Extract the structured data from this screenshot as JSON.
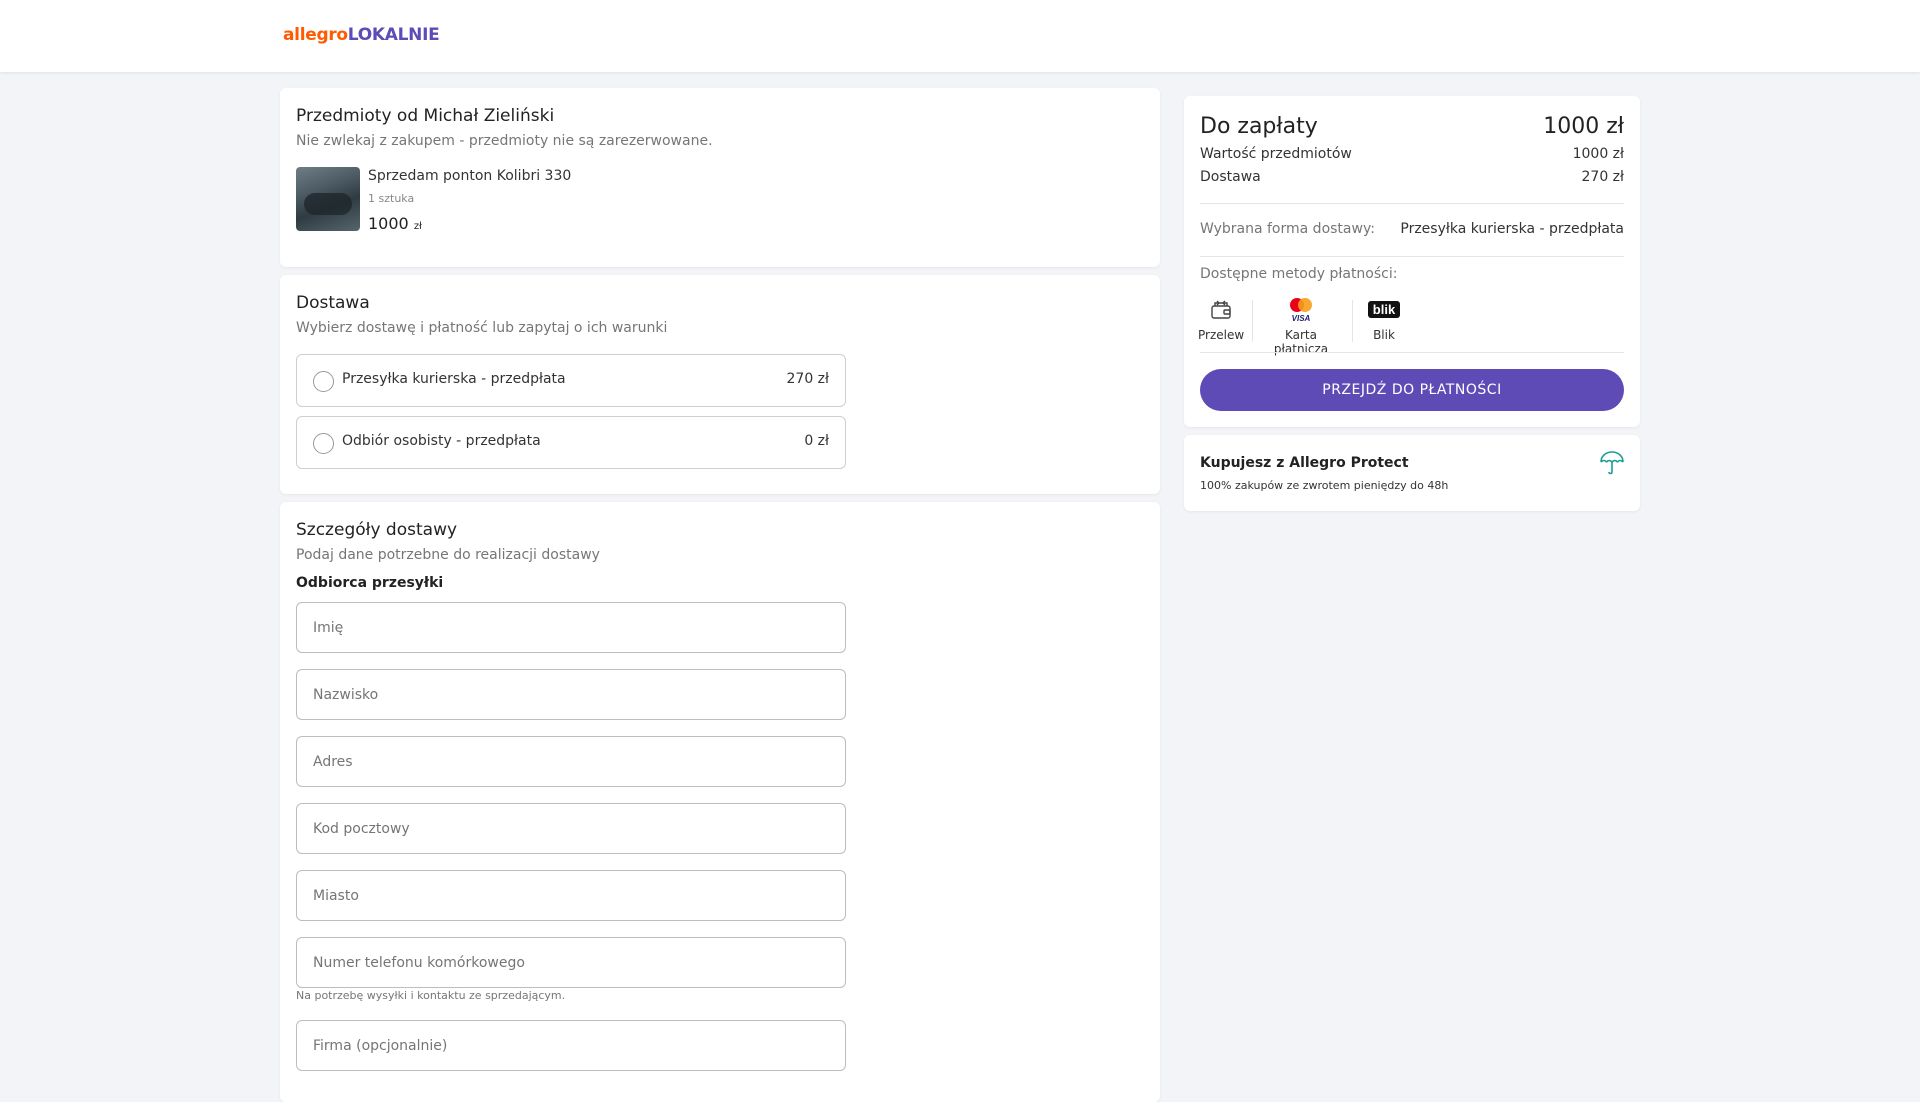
{
  "header": {
    "logo_part1": "allegro",
    "logo_part2": "LOKALNIE"
  },
  "items": {
    "title": "Przedmioty od Michał Zieliński",
    "subtitle": "Nie zwlekaj z zakupem - przedmioty nie są zarezerwowane.",
    "item": {
      "name": "Sprzedam ponton Kolibri 330",
      "qty": "1 sztuka",
      "price": "1000",
      "currency": "zł"
    }
  },
  "delivery": {
    "title": "Dostawa",
    "subtitle": "Wybierz dostawę i płatność lub zapytaj o ich warunki",
    "options": [
      {
        "label": "Przesyłka kurierska - przedpłata",
        "price": "270 zł"
      },
      {
        "label": "Odbiór osobisty - przedpłata",
        "price": "0 zł"
      }
    ]
  },
  "details": {
    "title": "Szczegóły dostawy",
    "subtitle": "Podaj dane potrzebne do realizacji dostawy",
    "recipient_label": "Odbiorca przesyłki",
    "fields": {
      "first_name": "Imię",
      "last_name": "Nazwisko",
      "address": "Adres",
      "postal_code": "Kod pocztowy",
      "city": "Miasto",
      "phone": "Numer telefonu komórkowego",
      "company": "Firma (opcjonalnie)"
    },
    "phone_hint": "Na potrzebę wysyłki i kontaktu ze sprzedającym."
  },
  "summary": {
    "title": "Do zapłaty",
    "total": "1000 zł",
    "items_label": "Wartość przedmiotów",
    "items_value": "1000 zł",
    "delivery_label": "Dostawa",
    "delivery_value": "270 zł",
    "chosen_label": "Wybrana forma dostawy:",
    "chosen_value": "Przesyłka kurierska - przedpłata",
    "methods_label": "Dostępne metody płatności:",
    "methods": [
      {
        "label": "Przelew",
        "icon": "wallet-icon"
      },
      {
        "label": "Karta płatnicza",
        "icon": "mastercard-visa-icon"
      },
      {
        "label": "Blik",
        "icon": "blik-icon"
      }
    ],
    "pay_button": "PRZEJDŹ DO PŁATNOŚCI",
    "brand_color": "#5f4bb6"
  },
  "protect": {
    "title": "Kupujesz z Allegro Protect",
    "subtitle": "100% zakupów ze zwrotem pieniędzy do 48h",
    "icon": "umbrella-icon"
  },
  "blik_logo_text": "blik",
  "visa_logo_text": "VISA"
}
